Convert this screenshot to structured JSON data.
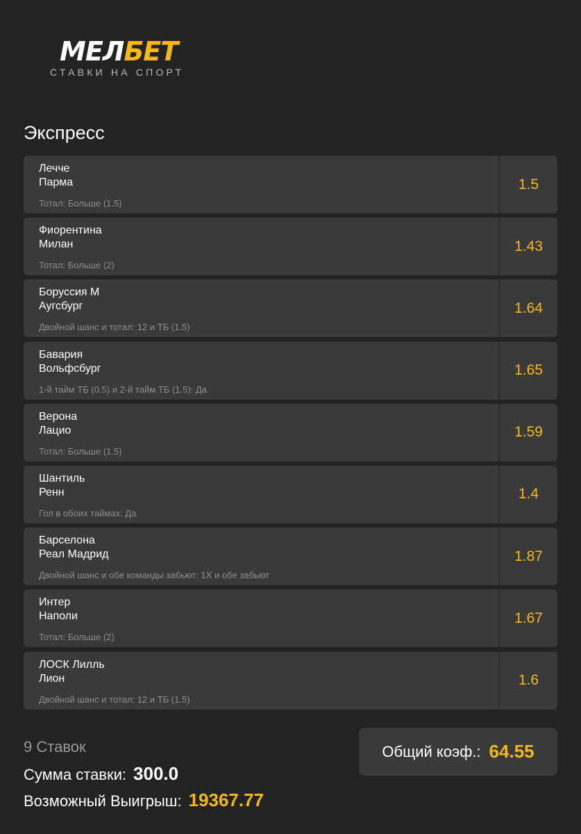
{
  "logo": {
    "word_a": "МЕЛ",
    "word_b": "БЕТ",
    "subtitle": "СТАВКИ НА СПОРТ",
    "colors": {
      "white": "#ffffff",
      "accent": "#f5b81c"
    }
  },
  "section_title": "Экспресс",
  "bets": [
    {
      "team1": "Лечче",
      "team2": "Парма",
      "market": "Тотал: Больше (1.5)",
      "odd": "1.5"
    },
    {
      "team1": "Фиорентина",
      "team2": "Милан",
      "market": "Тотал: Больше (2)",
      "odd": "1.43"
    },
    {
      "team1": "Боруссия М",
      "team2": "Аугсбург",
      "market": "Двойной шанс и тотал: 12 и ТБ (1.5)",
      "odd": "1.64"
    },
    {
      "team1": "Бавария",
      "team2": "Вольфсбург",
      "market": "1-й тайм ТБ (0.5) и 2-й тайм ТБ (1.5): Да",
      "odd": "1.65"
    },
    {
      "team1": "Верона",
      "team2": "Лацио",
      "market": "Тотал: Больше (1.5)",
      "odd": "1.59"
    },
    {
      "team1": "Шантиль",
      "team2": "Ренн",
      "market": "Гол в обоих таймах: Да",
      "odd": "1.4"
    },
    {
      "team1": "Барселона",
      "team2": "Реал Мадрид",
      "market": "Двойной шанс и обе команды забьют: 1X и обе забьют",
      "odd": "1.87"
    },
    {
      "team1": "Интер",
      "team2": "Наполи",
      "market": "Тотал: Больше (2)",
      "odd": "1.67"
    },
    {
      "team1": "ЛОСК Лилль",
      "team2": "Лион",
      "market": "Двойной шанс и тотал: 12 и ТБ (1.5)",
      "odd": "1.6"
    }
  ],
  "summary": {
    "count": "9 Ставок",
    "stake_label": "Сумма ставки:",
    "stake_value": "300.0",
    "win_label": "Возможный Выигрыш:",
    "win_value": "19367.77",
    "total_label": "Общий коэф.:",
    "total_value": "64.55"
  },
  "colors": {
    "background": "#232323",
    "card": "#3a3a3a",
    "accent": "#f5b81c",
    "muted": "#8e8e8e"
  }
}
